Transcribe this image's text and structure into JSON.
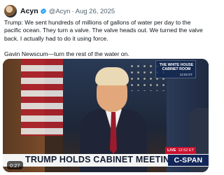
{
  "tweet": {
    "author_name": "Acyn",
    "handle": "@Acyn",
    "separator": "·",
    "date": "Aug 26, 2025",
    "paragraphs": [
      "Trump: We sent hundreds of millions of gallons of water per day to the pacific ocean. They turn a valve. The valve heads out. We turned the valve back. I actually had to do it using force.",
      "Gavin Newscum—turn the rest of the water on."
    ]
  },
  "video": {
    "overlay_title": "THE WHITE HOUSE\nCABINET ROOM",
    "overlay_time": "12:52 ET",
    "live_label": "LIVE",
    "live_time": "12:52 ET",
    "lower_third": "TRUMP HOLDS CABINET MEETING",
    "logo": "C-SPAN",
    "timestamp": "0:27"
  },
  "colors": {
    "text": "#0f1419",
    "muted": "#536471",
    "verified": "#1d9bf0",
    "live_red": "#c8102e",
    "cspan_blue": "#13265a"
  },
  "icons": {
    "verified": "verified-badge-icon"
  }
}
